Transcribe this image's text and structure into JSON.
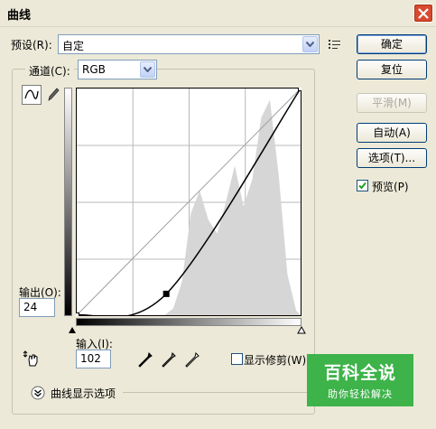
{
  "window": {
    "title": "曲线"
  },
  "preset": {
    "label": "预设(R):",
    "value": "自定"
  },
  "channel": {
    "label": "通道(C):",
    "value": "RGB"
  },
  "buttons": {
    "ok": "确定",
    "reset": "复位",
    "smooth": "平滑(M)",
    "auto": "自动(A)",
    "options": "选项(T)..."
  },
  "preview": {
    "label": "预览(P)",
    "checked": true
  },
  "output": {
    "label": "输出(O):",
    "value": "24"
  },
  "input": {
    "label": "输入(I):",
    "value": "102"
  },
  "show_clipping": {
    "label": "显示修剪(W)",
    "checked": false
  },
  "curve_options": {
    "label": "曲线显示选项"
  },
  "watermark": {
    "main": "百科全说",
    "sub": "助你轻松解决"
  },
  "curve": {
    "x_range": [
      0,
      255
    ],
    "y_range": [
      0,
      255
    ],
    "points": [
      [
        0,
        0
      ],
      [
        102,
        24
      ],
      [
        255,
        255
      ]
    ],
    "selected_point": [
      102,
      24
    ]
  },
  "histogram": {
    "x": [
      0,
      40,
      60,
      80,
      100,
      110,
      120,
      130,
      140,
      150,
      160,
      170,
      180,
      190,
      200,
      210,
      220,
      230,
      240,
      250,
      255
    ],
    "values": [
      0,
      0,
      0,
      0,
      0,
      3,
      15,
      45,
      55,
      42,
      36,
      50,
      66,
      48,
      60,
      87,
      95,
      62,
      18,
      2,
      0
    ]
  },
  "icons": {
    "close": "close-icon",
    "curve_tool": "curve-point-icon",
    "pencil_tool": "pencil-icon",
    "preset_menu": "menu-icon",
    "hand_adjust": "hand-adjust-icon",
    "black_point": "black-eyedropper-icon",
    "gray_point": "gray-eyedropper-icon",
    "white_point": "white-eyedropper-icon",
    "expand": "chevron-down-circle-icon"
  },
  "colors": {
    "grid": "#b8b8b8",
    "histogram": "#d6d6d6",
    "curve": "#000000",
    "baseline": "#a0a0a0"
  }
}
